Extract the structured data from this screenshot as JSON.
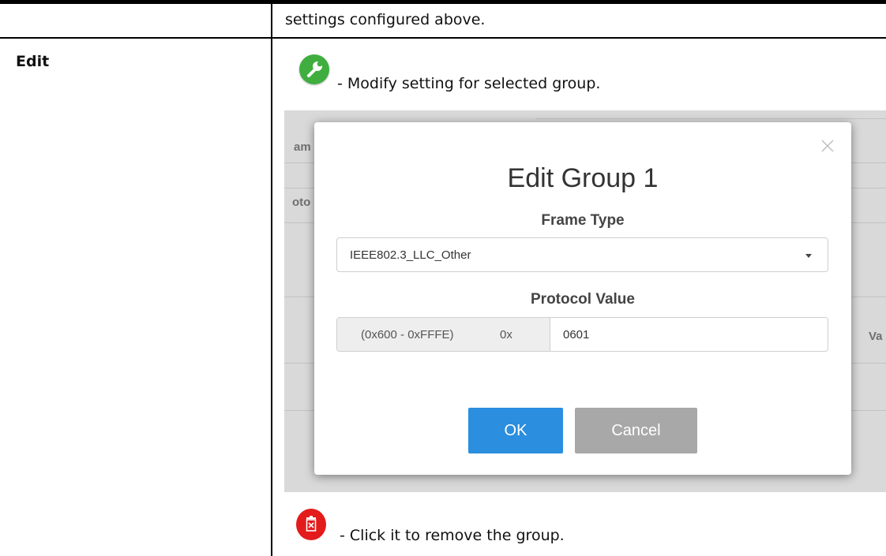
{
  "table": {
    "previous_row_text": "settings configured above.",
    "row_label": "Edit",
    "edit_description": "- Modify setting for selected group.",
    "delete_description": "- Click it to remove the group."
  },
  "icons": {
    "edit": "wrench-icon",
    "delete": "trash-icon",
    "edit_color": "#3fae3f",
    "delete_color": "#e31b1b"
  },
  "dialog": {
    "title": "Edit Group 1",
    "frame_type_label": "Frame Type",
    "frame_type_value": "IEEE802.3_LLC_Other",
    "protocol_value_label": "Protocol Value",
    "protocol_range": "(0x600 - 0xFFFE)",
    "protocol_prefix": "0x",
    "protocol_value": "0601",
    "ok_label": "OK",
    "cancel_label": "Cancel",
    "ok_color": "#2b8ede",
    "cancel_color": "#a8a8a8"
  },
  "background_fragments": {
    "frag1": "am",
    "frag2": "oto",
    "frag3": "Va"
  }
}
